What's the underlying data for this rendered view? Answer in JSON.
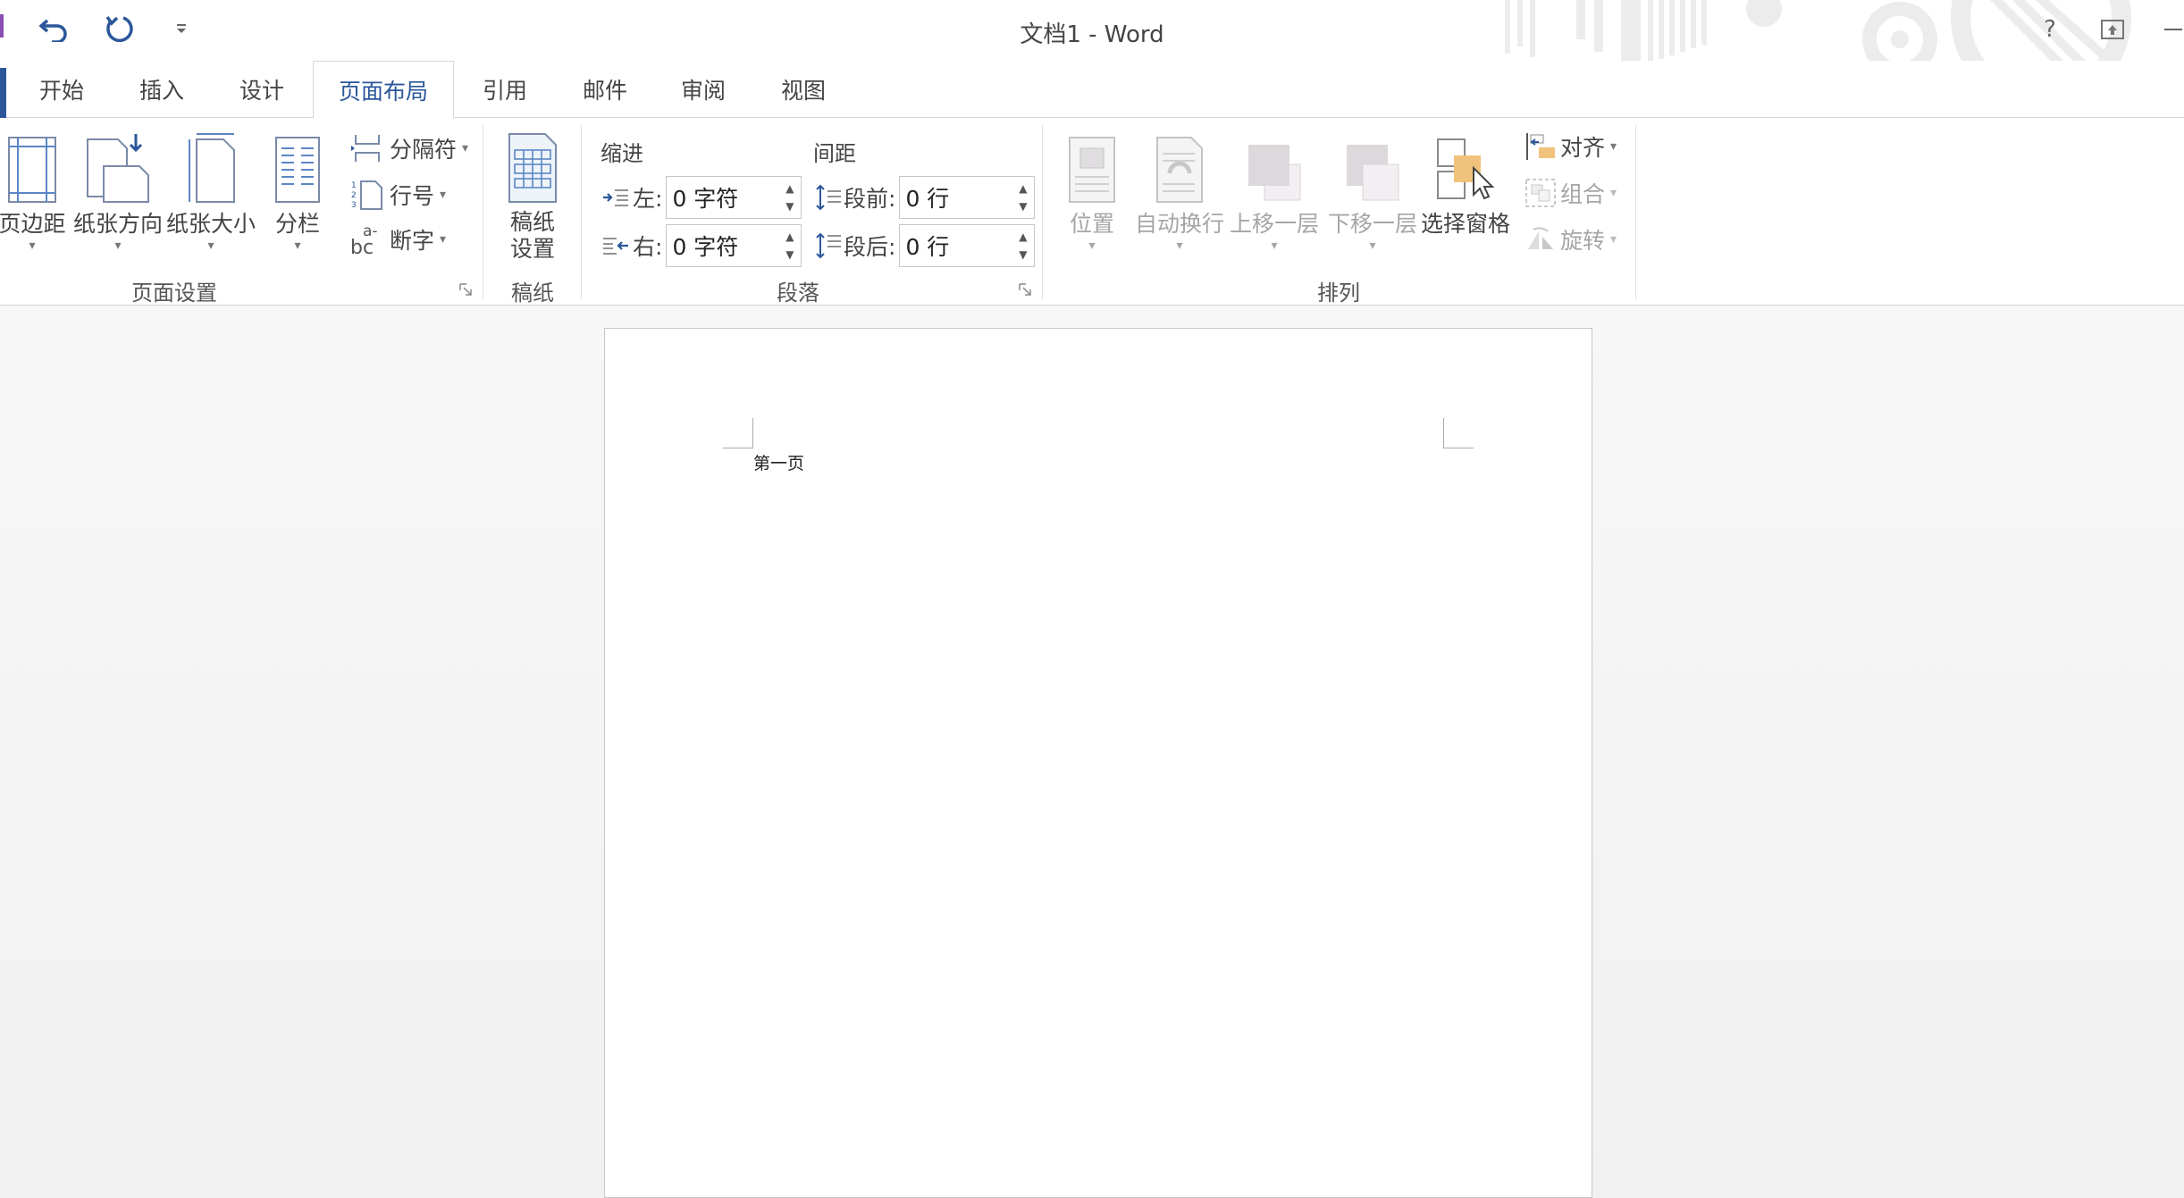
{
  "window": {
    "title": "文档1 - Word"
  },
  "quick_access": {
    "undo_icon": "undo-icon",
    "redo_icon": "redo-icon",
    "customize_icon": "customize-dropdown-icon"
  },
  "window_controls": {
    "help": "?",
    "ribbon_display_icon": "ribbon-display-options-icon",
    "minimize_icon": "minimize-icon"
  },
  "tabs": [
    {
      "label": "开始"
    },
    {
      "label": "插入"
    },
    {
      "label": "设计"
    },
    {
      "label": "页面布局",
      "active": true
    },
    {
      "label": "引用"
    },
    {
      "label": "邮件"
    },
    {
      "label": "审阅"
    },
    {
      "label": "视图"
    }
  ],
  "ribbon": {
    "page_setup": {
      "label": "页面设置",
      "margins": "页边距",
      "orientation": "纸张方向",
      "size": "纸张大小",
      "columns": "分栏",
      "breaks": "分隔符",
      "line_numbers": "行号",
      "hyphenation": "断字"
    },
    "draft_paper": {
      "label": "稿纸",
      "button_line1": "稿纸",
      "button_line2": "设置"
    },
    "paragraph": {
      "label": "段落",
      "indent_header": "缩进",
      "spacing_header": "间距",
      "indent_left_label": "左:",
      "indent_left_value": "0 字符",
      "indent_right_label": "右:",
      "indent_right_value": "0 字符",
      "spacing_before_label": "段前:",
      "spacing_before_value": "0 行",
      "spacing_after_label": "段后:",
      "spacing_after_value": "0 行"
    },
    "arrange": {
      "label": "排列",
      "position": "位置",
      "wrap_text": "自动换行",
      "bring_forward": "上移一层",
      "send_backward": "下移一层",
      "selection_pane": "选择窗格",
      "align": "对齐",
      "group": "组合",
      "rotate": "旋转"
    }
  },
  "document": {
    "header_text": "第一页"
  },
  "colors": {
    "accent": "#2b579a",
    "qat_accent": "#8a4db5",
    "disabled": "#a6a6a6"
  }
}
